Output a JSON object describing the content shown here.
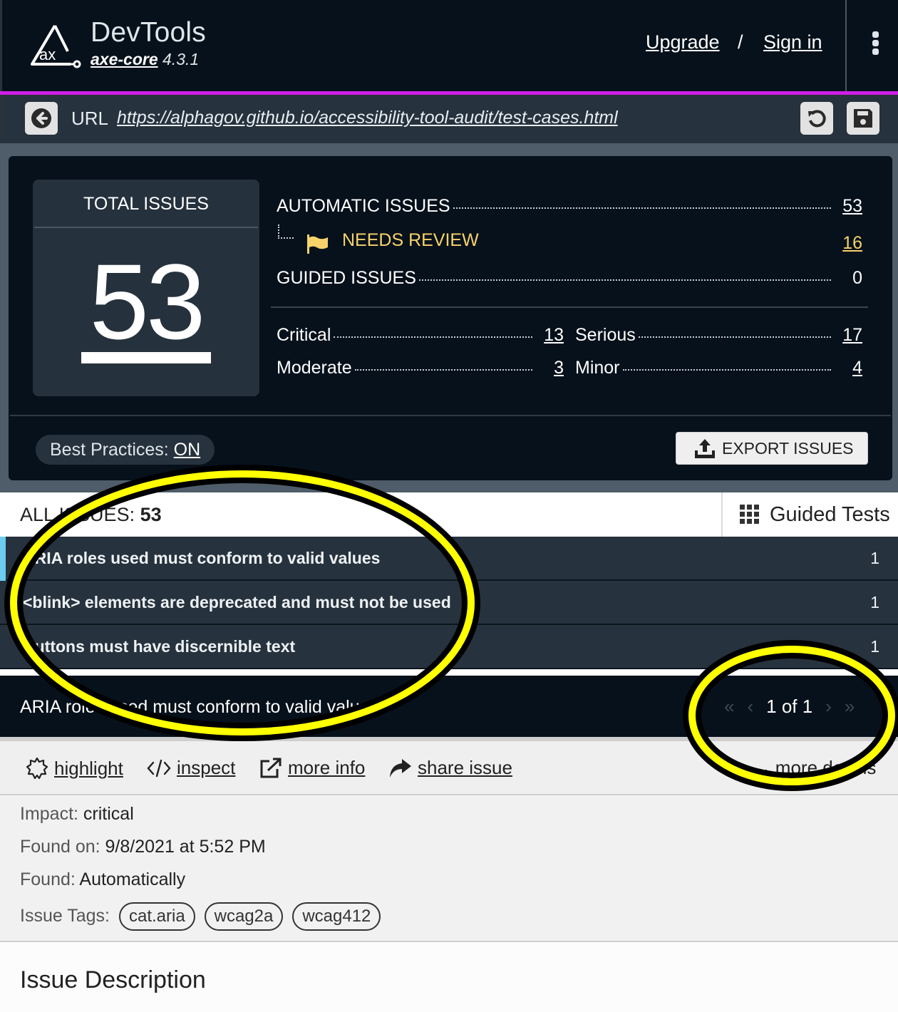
{
  "header": {
    "title": "DevTools",
    "engine_link": "axe-core",
    "engine_version": "4.3.1",
    "upgrade": "Upgrade",
    "separator": "/",
    "sign_in": "Sign in",
    "accent_color": "#d21ee8"
  },
  "urlbar": {
    "label": "URL",
    "url": "https://alphagov.github.io/accessibility-tool-audit/test-cases.html"
  },
  "summary": {
    "total_label": "TOTAL ISSUES",
    "total": "53",
    "automatic_label": "AUTOMATIC ISSUES",
    "automatic": "53",
    "needs_review_label": "NEEDS REVIEW",
    "needs_review": "16",
    "guided_label": "GUIDED ISSUES",
    "guided": "0",
    "critical_label": "Critical",
    "critical": "13",
    "serious_label": "Serious",
    "serious": "17",
    "moderate_label": "Moderate",
    "moderate": "3",
    "minor_label": "Minor",
    "minor": "4",
    "best_practices_label": "Best Practices: ",
    "best_practices_value": "ON",
    "export_label": "EXPORT ISSUES",
    "review_color": "#f6d36b"
  },
  "list": {
    "all_issues_label": "ALL ISSUES: ",
    "all_issues_count": "53",
    "guided_tests_label": "Guided Tests",
    "items": [
      {
        "title": "ARIA roles used must conform to valid values",
        "count": "1"
      },
      {
        "title": "<blink> elements are deprecated and must not be used",
        "count": "1"
      },
      {
        "title": "Buttons must have discernible text",
        "count": "1"
      }
    ]
  },
  "detail": {
    "title": "ARIA roles used must conform to valid values",
    "pager": {
      "first": "«",
      "prev": "‹",
      "label": "1 of 1",
      "next": "›",
      "last": "»"
    },
    "actions": {
      "highlight": "highlight",
      "inspect": "inspect",
      "more_info": "more info",
      "share": "share issue",
      "more_details": "more details"
    },
    "impact_label": "Impact: ",
    "impact": "critical",
    "found_on_label": "Found on: ",
    "found_on": "9/8/2021 at 5:52 PM",
    "found_label": "Found: ",
    "found": "Automatically",
    "tags_label": "Issue Tags:",
    "tags": [
      "cat.aria",
      "wcag2a",
      "wcag412"
    ],
    "description_heading": "Issue Description"
  }
}
